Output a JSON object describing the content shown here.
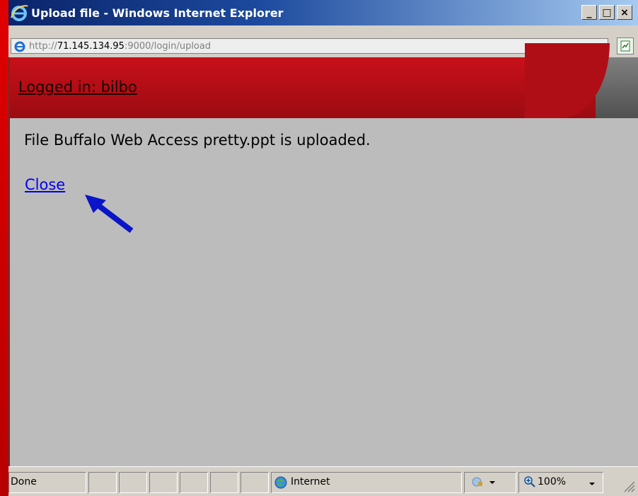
{
  "window": {
    "title": "Upload file - Windows Internet Explorer",
    "controls": {
      "minimize": "_",
      "maximize": "□",
      "close": "×"
    }
  },
  "address": {
    "scheme": "http://",
    "host": "71.145.134.95",
    "rest": ":9000/login/upload"
  },
  "page": {
    "login_text": "Logged in: bilbo",
    "message": "File Buffalo Web Access pretty.ppt is uploaded.",
    "close_link": "Close"
  },
  "status": {
    "text": "Done",
    "zone": "Internet",
    "zoom": "100%"
  },
  "colors": {
    "banner": "#c8101a",
    "link": "#0000ee",
    "arrow": "#0a14c8"
  }
}
